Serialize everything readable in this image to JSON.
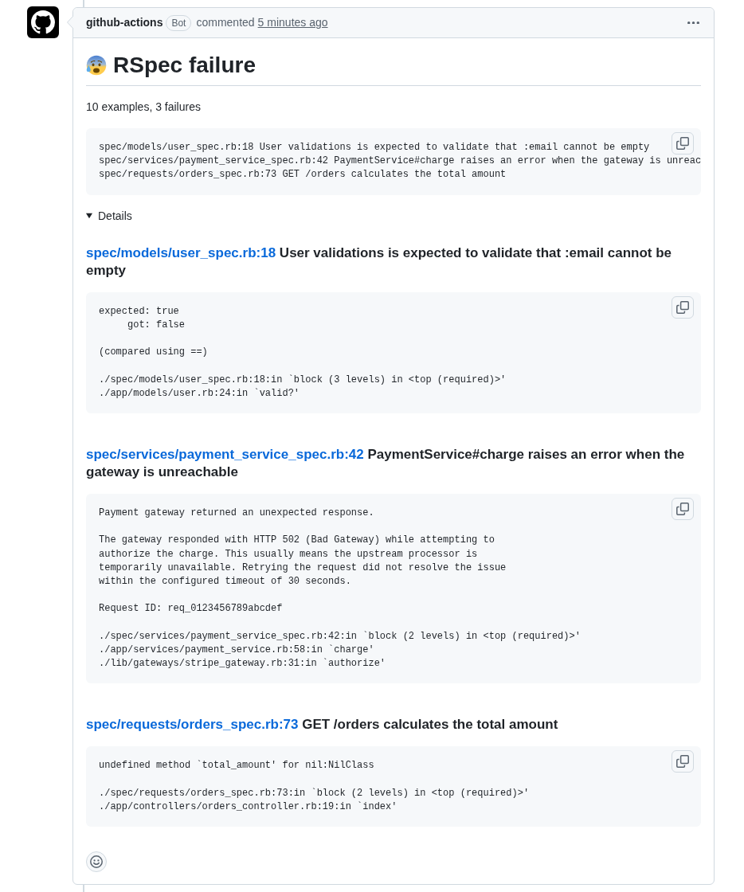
{
  "comment": {
    "author": "github-actions",
    "badge": "Bot",
    "action": "commented",
    "timestamp": "5 minutes ago"
  },
  "title": "RSpec failure",
  "summary": "10 examples, 3 failures",
  "summary_output": [
    [
      "spec/models/user_spec.rb:18 User validations is expected to validate that :email cannot be empty",
      "spec/services/payment_service_spec.rb:42 PaymentService#charge raises an error when the gateway is unreac",
      "spec/requests/orders_spec.rb:73 GET /orders calculates the total amount"
    ]
  ],
  "details": {
    "label": "Details",
    "expanded": true,
    "failures": [
      {
        "file_link": "spec/models/user_spec.rb:18",
        "description": "User validations is expected to validate that :email cannot be empty",
        "output": [
          [
            "expected: true",
            "     got: false"
          ],
          [
            "(compared using ==)"
          ],
          [
            "./spec/models/user_spec.rb:18:in `block (3 levels) in <top (required)>'",
            "./app/models/user.rb:24:in `valid?'"
          ]
        ]
      },
      {
        "file_link": "spec/services/payment_service_spec.rb:42",
        "description": "PaymentService#charge raises an error when the gateway is unreachable",
        "output": [
          [
            "Payment gateway returned an unexpected response."
          ],
          [
            "The gateway responded with HTTP 502 (Bad Gateway) while attempting to",
            "authorize the charge. This usually means the upstream processor is",
            "temporarily unavailable. Retrying the request did not resolve the issue",
            "within the configured timeout of 30 seconds."
          ],
          [
            "Request ID: req_0123456789abcdef"
          ],
          [
            "./spec/services/payment_service_spec.rb:42:in `block (2 levels) in <top (required)>'",
            "./app/services/payment_service.rb:58:in `charge'",
            "./lib/gateways/stripe_gateway.rb:31:in `authorize'"
          ]
        ]
      },
      {
        "file_link": "spec/requests/orders_spec.rb:73",
        "description": "GET /orders calculates the total amount",
        "output": [
          [
            "undefined method `total_amount' for nil:NilClass"
          ],
          [
            "./spec/requests/orders_spec.rb:73:in `block (2 levels) in <top (required)>'",
            "./app/controllers/orders_controller.rb:19:in `index'"
          ]
        ]
      }
    ]
  }
}
